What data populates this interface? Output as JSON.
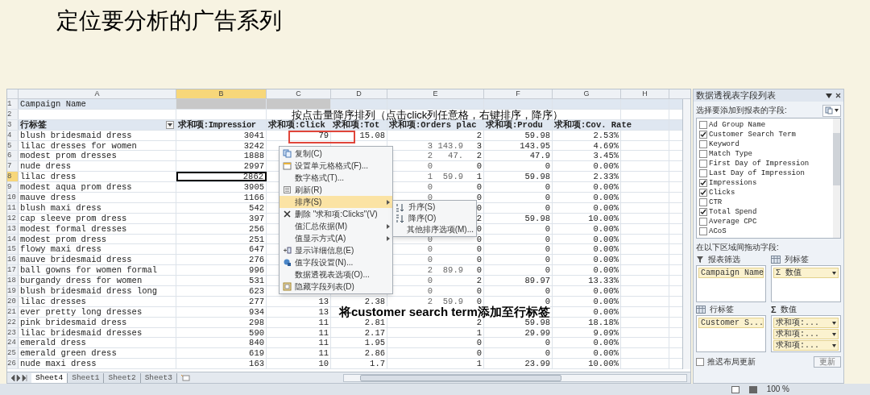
{
  "slide": {
    "title": "定位要分析的广告系列"
  },
  "annotations": [
    {
      "kind": "top",
      "text": "按点击量降序排列（点击click列任意格，右键排序，降序）"
    },
    {
      "kind": "bottom",
      "text": "将customer search term添加至行标签"
    }
  ],
  "sheet": {
    "columns": [
      {
        "label": "A",
        "selected": false
      },
      {
        "label": "B",
        "selected": true
      },
      {
        "label": "C",
        "selected": false
      },
      {
        "label": "D",
        "selected": false
      },
      {
        "label": "E",
        "selected": false
      },
      {
        "label": "F",
        "selected": false
      },
      {
        "label": "G",
        "selected": false
      },
      {
        "label": "H",
        "selected": false
      }
    ],
    "rows": [
      {
        "number": "1",
        "kind": "filter",
        "selected": false,
        "cells": [
          "Campaign Name",
          null,
          null,
          null,
          null,
          null,
          null
        ]
      },
      {
        "number": "2",
        "kind": "blank",
        "selected": false,
        "cells": [
          null,
          null,
          null,
          null,
          null,
          null,
          null
        ]
      },
      {
        "number": "3",
        "kind": "header",
        "selected": false,
        "cells": [
          "行标签",
          "求和项:Impressior",
          "求和项:Click",
          "求和项:Tot",
          "求和项:Orders plac",
          "求和项:Produ",
          "求和项:Cov. Rate"
        ]
      },
      {
        "number": "4",
        "kind": "data",
        "selected": false,
        "cells": [
          "blush bridesmaid dress",
          "3041",
          "79",
          "15.08",
          "2",
          "59.98",
          "2.53%"
        ]
      },
      {
        "number": "5",
        "kind": "data",
        "selected": false,
        "ghost": [
          "3",
          "143.9"
        ],
        "cells": [
          "lilac dresses for women",
          "3242",
          null,
          null,
          "3",
          "143.95",
          "4.69%"
        ]
      },
      {
        "number": "6",
        "kind": "data",
        "selected": false,
        "ghost": [
          "2",
          "47."
        ],
        "cells": [
          "modest prom dresses",
          "1888",
          null,
          null,
          "2",
          "47.9",
          "3.45%"
        ]
      },
      {
        "number": "7",
        "kind": "data",
        "selected": false,
        "ghost": [
          "0"
        ],
        "cells": [
          "nude dress",
          "2997",
          null,
          null,
          "0",
          "0",
          "0.00%"
        ]
      },
      {
        "number": "8",
        "kind": "data",
        "selected": true,
        "ghost": [
          "1",
          "59.9"
        ],
        "cells": [
          "lilac dress",
          "2862",
          null,
          null,
          "1",
          "59.98",
          "2.33%"
        ]
      },
      {
        "number": "9",
        "kind": "data",
        "selected": false,
        "ghost": [
          "0"
        ],
        "cells": [
          "modest aqua prom dress",
          "3905",
          null,
          null,
          "0",
          "0",
          "0.00%"
        ]
      },
      {
        "number": "10",
        "kind": "data",
        "selected": false,
        "ghost": [
          "0"
        ],
        "cells": [
          "mauve dress",
          "1166",
          null,
          null,
          "0",
          "0",
          "0.00%"
        ]
      },
      {
        "number": "11",
        "kind": "data",
        "selected": false,
        "cells": [
          "blush maxi dress",
          "542",
          null,
          null,
          "0",
          "0",
          "0.00%"
        ]
      },
      {
        "number": "12",
        "kind": "data",
        "selected": false,
        "cells": [
          "cap sleeve prom dress",
          "397",
          null,
          null,
          "2",
          "59.98",
          "10.00%"
        ]
      },
      {
        "number": "13",
        "kind": "data",
        "selected": false,
        "cells": [
          "modest formal dresses",
          "256",
          null,
          null,
          "0",
          "0",
          "0.00%"
        ]
      },
      {
        "number": "14",
        "kind": "data",
        "selected": false,
        "ghost": [
          "0"
        ],
        "cells": [
          "modest prom dress",
          "251",
          null,
          null,
          "0",
          "0",
          "0.00%"
        ]
      },
      {
        "number": "15",
        "kind": "data",
        "selected": false,
        "ghost": [
          "0"
        ],
        "cells": [
          "flowy maxi dress",
          "647",
          null,
          null,
          "0",
          "0",
          "0.00%"
        ]
      },
      {
        "number": "16",
        "kind": "data",
        "selected": false,
        "ghost": [
          "0"
        ],
        "cells": [
          "mauve bridesmaid dress",
          "276",
          null,
          null,
          "0",
          "0",
          "0.00%"
        ]
      },
      {
        "number": "17",
        "kind": "data",
        "selected": false,
        "ghost": [
          "2",
          "89.9"
        ],
        "cells": [
          "ball gowns for women formal",
          "996",
          null,
          null,
          "0",
          "0",
          "0.00%"
        ]
      },
      {
        "number": "18",
        "kind": "data",
        "selected": false,
        "ghost": [
          "0"
        ],
        "cells": [
          "burgandy dress for women",
          "531",
          null,
          null,
          "2",
          "89.97",
          "13.33%"
        ]
      },
      {
        "number": "19",
        "kind": "data",
        "selected": false,
        "ghost": [
          "0"
        ],
        "cells": [
          "blush bridesmaid dress long",
          "623",
          null,
          null,
          "0",
          "0",
          "0.00%"
        ]
      },
      {
        "number": "20",
        "kind": "data",
        "selected": false,
        "ghost": [
          "2",
          "59.9"
        ],
        "cells": [
          "lilac dresses",
          "277",
          "13",
          "2.38",
          "0",
          "0",
          "0.00%"
        ]
      },
      {
        "number": "21",
        "kind": "data",
        "selected": false,
        "cells": [
          "ever pretty long dresses",
          "934",
          "13",
          null,
          null,
          null,
          "0.00%"
        ]
      },
      {
        "number": "22",
        "kind": "data",
        "selected": false,
        "cells": [
          "pink bridesmaid dress",
          "298",
          "11",
          "2.81",
          "2",
          "59.98",
          "18.18%"
        ]
      },
      {
        "number": "23",
        "kind": "data",
        "selected": false,
        "cells": [
          "lilac bridesmaid dresses",
          "590",
          "11",
          "2.17",
          "1",
          "29.99",
          "9.09%"
        ]
      },
      {
        "number": "24",
        "kind": "data",
        "selected": false,
        "cells": [
          "emerald dress",
          "840",
          "11",
          "1.95",
          "0",
          "0",
          "0.00%"
        ]
      },
      {
        "number": "25",
        "kind": "data",
        "selected": false,
        "cells": [
          "emerald green dress",
          "619",
          "11",
          "2.86",
          "0",
          "0",
          "0.00%"
        ]
      },
      {
        "number": "26",
        "kind": "data",
        "selected": false,
        "cells": [
          "nude maxi dress",
          "163",
          "10",
          "1.7",
          "1",
          "23.99",
          "10.00%"
        ]
      }
    ],
    "tabs": [
      {
        "label": "Sheet4",
        "selected": true
      },
      {
        "label": "Sheet1",
        "selected": false
      },
      {
        "label": "Sheet2",
        "selected": false
      },
      {
        "label": "Sheet3",
        "selected": false
      }
    ]
  },
  "context_menu": {
    "items": [
      {
        "label": "复制(C)",
        "kind": "copy",
        "submenu": false,
        "selected": false
      },
      {
        "label": "设置单元格格式(F)...",
        "kind": "format",
        "submenu": false,
        "selected": false
      },
      {
        "label": "数字格式(T)...",
        "kind": "plain",
        "submenu": false,
        "selected": false
      },
      {
        "label": "刷新(R)",
        "kind": "refresh",
        "submenu": false,
        "selected": false
      },
      {
        "label": "排序(S)",
        "kind": "plain",
        "submenu": true,
        "selected": true
      },
      {
        "label": "删除 \"求和项:Clicks\"(V)",
        "kind": "delete",
        "submenu": false,
        "selected": false
      },
      {
        "label": "值汇总依据(M)",
        "kind": "plain",
        "submenu": true,
        "selected": false
      },
      {
        "label": "值显示方式(A)",
        "kind": "plain",
        "submenu": true,
        "selected": false
      },
      {
        "label": "显示详细信息(E)",
        "kind": "details",
        "submenu": false,
        "selected": false
      },
      {
        "label": "值字段设置(N)...",
        "kind": "settings",
        "submenu": false,
        "selected": false
      },
      {
        "label": "数据透视表选项(O)...",
        "kind": "plain",
        "submenu": false,
        "selected": false
      },
      {
        "label": "隐藏字段列表(D)",
        "kind": "hide",
        "submenu": false,
        "selected": false
      }
    ],
    "submenu": [
      {
        "label": "升序(S)",
        "kind": "ascending"
      },
      {
        "label": "降序(O)",
        "kind": "descending"
      },
      {
        "label": "其他排序选项(M)...",
        "kind": "plain"
      }
    ]
  },
  "field_list": {
    "title": "数据透视表字段列表",
    "prompt": "选择要添加到报表的字段:",
    "fields": [
      {
        "label": "Ad Group Name",
        "checked": false
      },
      {
        "label": "Customer Search Term",
        "checked": true
      },
      {
        "label": "Keyword",
        "checked": false
      },
      {
        "label": "Match Type",
        "checked": false
      },
      {
        "label": "First Day of Impression",
        "checked": false
      },
      {
        "label": "Last Day of Impression",
        "checked": false
      },
      {
        "label": "Impressions",
        "checked": true
      },
      {
        "label": "Clicks",
        "checked": true
      },
      {
        "label": "CTR",
        "checked": false
      },
      {
        "label": "Total Spend",
        "checked": true
      },
      {
        "label": "Average CPC",
        "checked": false
      },
      {
        "label": "ACoS",
        "checked": false
      }
    ],
    "drag_prompt": "在以下区域间拖动字段:",
    "areas": [
      {
        "kind": "filter",
        "label": "报表筛选",
        "items": [
          "Campaign Name"
        ]
      },
      {
        "kind": "columns",
        "label": "列标签",
        "items": [
          "Σ 数值"
        ]
      },
      {
        "kind": "rows",
        "label": "行标签",
        "items": [
          "Customer S..."
        ]
      },
      {
        "kind": "values",
        "icon": "Σ",
        "label": "数值",
        "items": [
          "求和项:...",
          "求和项:...",
          "求和项:..."
        ]
      }
    ],
    "defer": {
      "label": "推迟布局更新",
      "checked": false
    },
    "update_button": "更新"
  },
  "status_bar": {
    "zoom": "100 %"
  }
}
